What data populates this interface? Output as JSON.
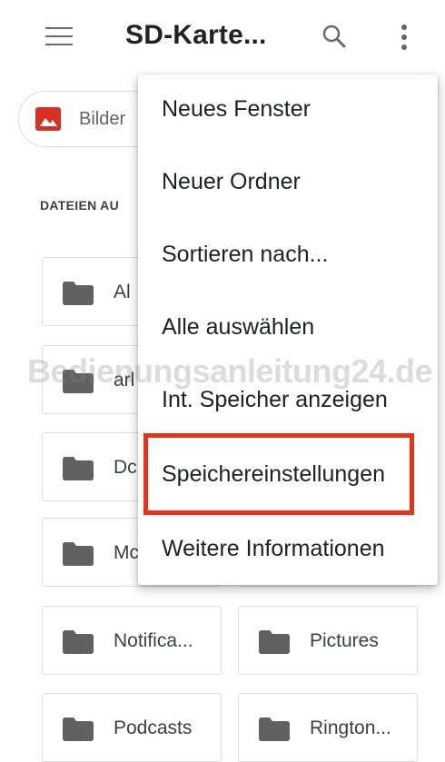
{
  "app_bar": {
    "title": "SD-Karte...",
    "menu_icon": "hamburger-menu-icon",
    "search_icon": "search-icon",
    "more_icon": "more-vert-icon"
  },
  "filter_chip": {
    "label": "Bilder",
    "icon": "image-icon",
    "icon_color": "#d93025"
  },
  "section_label": "DATEIEN AU",
  "tiles": [
    {
      "label": "Al"
    },
    {
      "label": "arl"
    },
    {
      "label": "Dc"
    },
    {
      "label": "Mc"
    },
    {
      "label": "Notifica..."
    },
    {
      "label": "Pictures"
    },
    {
      "label": "Podcasts"
    },
    {
      "label": "Rington..."
    }
  ],
  "overflow_menu": {
    "items": [
      {
        "label": "Neues Fenster"
      },
      {
        "label": "Neuer Ordner"
      },
      {
        "label": "Sortieren nach..."
      },
      {
        "label": "Alle auswählen"
      },
      {
        "label": "Int. Speicher anzeigen"
      },
      {
        "label": "Speichereinstellungen",
        "highlighted": true
      },
      {
        "label": "Weitere Informationen"
      }
    ],
    "highlight_color": "#e8321b"
  },
  "watermark": "Bedienungsanleitung24.de"
}
